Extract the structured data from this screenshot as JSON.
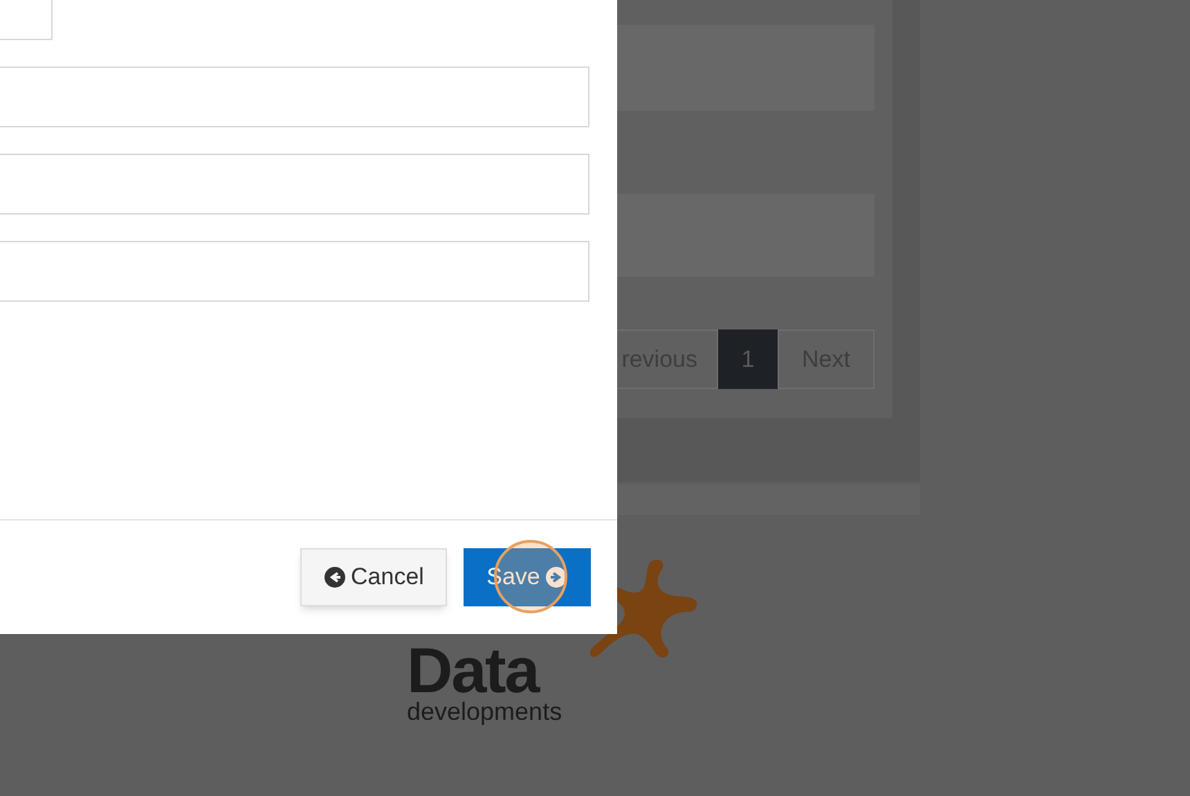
{
  "modal": {
    "fields": [
      {
        "kind": "short"
      },
      {
        "kind": "wide"
      },
      {
        "kind": "wide"
      },
      {
        "kind": "wide"
      }
    ],
    "buttons": [
      {
        "label": "Cancel",
        "kind": "secondary"
      },
      {
        "label": "Save",
        "kind": "primary"
      }
    ]
  },
  "pagination": {
    "previous": "revious",
    "pages": [
      {
        "label": "1",
        "selected": true
      }
    ],
    "next": "Next"
  },
  "logo": {
    "word": "Data",
    "tagline": "developments"
  }
}
